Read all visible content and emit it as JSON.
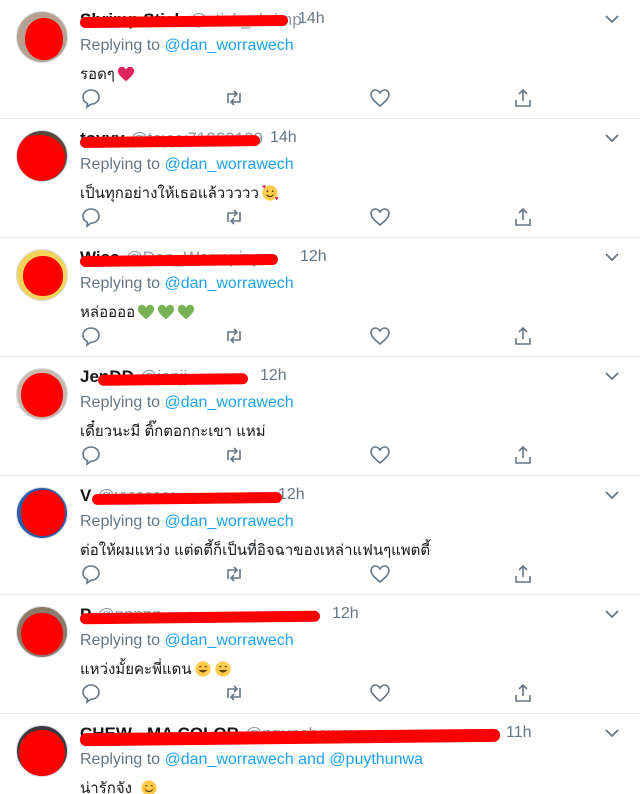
{
  "colors": {
    "accent": "#1da1f2",
    "muted": "#657786",
    "redaction": "#ff0000",
    "divider": "#e6ecf0"
  },
  "tweets": [
    {
      "name": "Shrimp Stick",
      "handle": "@stick_shrimp",
      "time": "14h",
      "replying_prefix": "Replying to",
      "mention": "@dan_worrawech",
      "text": "รอดๆ",
      "emoji": [
        "red-heart"
      ]
    },
    {
      "name": "toyyy",
      "handle": "@toyyy71060109",
      "time": "14h",
      "replying_prefix": "Replying to",
      "mention": "@dan_worrawech",
      "text": "เป็นทุกอย่างให้เธอแล้ววววว",
      "emoji": [
        "smiling-face-with-hearts"
      ]
    },
    {
      "name": "Wiss",
      "handle": "@Dan_Worrapinya",
      "time": "12h",
      "replying_prefix": "Replying to",
      "mention": "@dan_worrawech",
      "text": "หล่ออออ",
      "emoji": [
        "green-heart",
        "green-heart",
        "green-heart"
      ]
    },
    {
      "name": "JenDD",
      "handle": "@jenjj",
      "time": "12h",
      "replying_prefix": "Replying to",
      "mention": "@dan_worrawech",
      "text": "เดี๋ยวนะมี ติ๊กตอกกะเขา แหม่",
      "emoji": []
    },
    {
      "name": "V",
      "handle": "@vvvvvvv",
      "time": "12h",
      "replying_prefix": "Replying to",
      "mention": "@dan_worrawech",
      "text": "ต่อให้ผมแหว่ง แต่ดตี้ก็เป็นที่อิจฉาของเหล่าแฟนๆแพตตี้",
      "emoji": []
    },
    {
      "name": "P",
      "handle": "@ppppp",
      "time": "12h",
      "replying_prefix": "Replying to",
      "mention": "@dan_worrawech",
      "text": "แหว่งมั้ยคะพี่แดน",
      "emoji": [
        "grinning-face",
        "grinning-face"
      ]
    },
    {
      "name": "CHEW - MA COLOR",
      "handle": "@ngunchewma",
      "time": "11h",
      "replying_prefix": "Replying to",
      "mention": "@dan_worrawech",
      "connector": "and",
      "mention2": "@puythunwa",
      "text": "น่ารักจัง",
      "emoji": [
        "smiling-face"
      ]
    }
  ]
}
